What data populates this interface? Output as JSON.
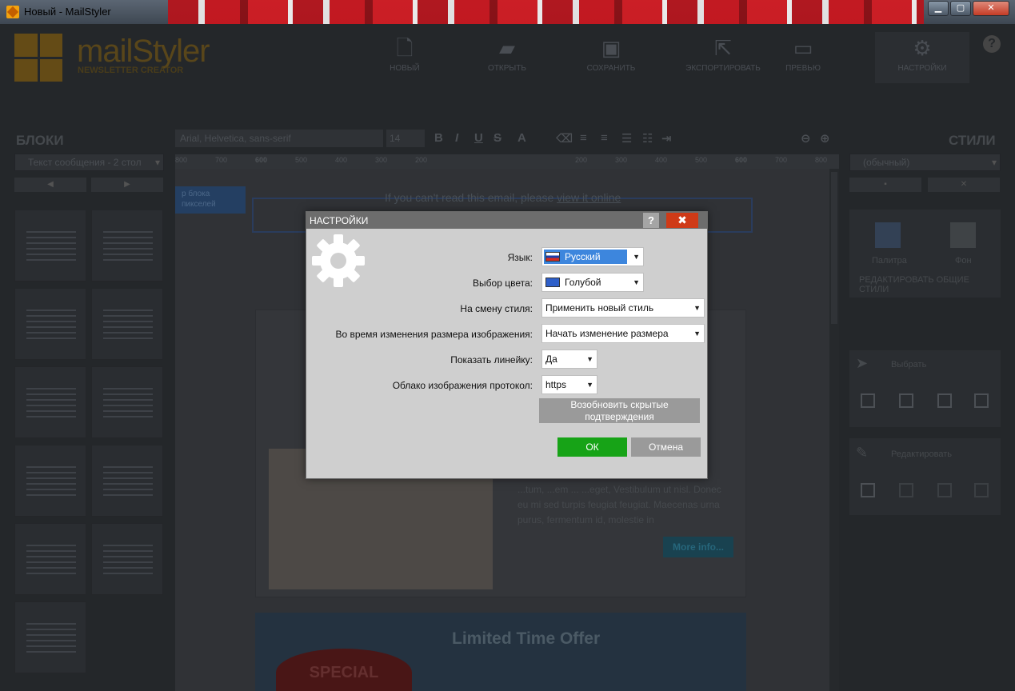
{
  "window": {
    "title": "Новый - MailStyler",
    "minimize": "▁",
    "maximize": "▢",
    "close": "✕"
  },
  "logo": {
    "name": "mailStyler",
    "subtitle": "NEWSLETTER CREATOR"
  },
  "toolbar": [
    {
      "label": "НОВЫЙ",
      "icon": "new-document-icon"
    },
    {
      "label": "ОТКРЫТЬ",
      "icon": "folder-open-icon"
    },
    {
      "label": "СОХРАНИТЬ",
      "icon": "save-icon"
    },
    {
      "label": "ЭКСПОРТИРОВАТЬ",
      "icon": "export-icon"
    },
    {
      "label": "ПРЕВЬЮ",
      "icon": "monitor-icon"
    },
    {
      "label": "НАСТРОЙКИ",
      "icon": "gear-icon"
    }
  ],
  "help_glyph": "?",
  "left_panel": {
    "title": "БЛОКИ",
    "select_value": "Текст сообщения - 2 стол",
    "prev_glyph": "◀",
    "next_glyph": "▶"
  },
  "editor": {
    "font": "Arial, Helvetica, sans-serif",
    "size": "14",
    "ruler_labels": [
      "800",
      "700",
      "600",
      "500",
      "400",
      "300",
      "200",
      "200",
      "300",
      "400",
      "500",
      "600",
      "700",
      "800"
    ],
    "preheader_text": "If you can't read this email, please ",
    "preheader_link": "view it online",
    "block_tag_1": "р блока",
    "block_tag_2": "пикселей",
    "lorem": "...tum, ...em ... ...eget, Vestibulum ut nisl. Donec eu mi sed turpis feugiat feugiat. Maecenas urna purus, fermentum id, molestie in",
    "more_button": "More info...",
    "offer_title": "Limited Time Offer",
    "offer_badge": "SPECIAL"
  },
  "right_panel": {
    "title": "СТИЛИ",
    "select_value": "(обычный)",
    "palette_label": "Палитра",
    "background_label": "Фон",
    "edit_common": "РЕДАКТИРОВАТЬ ОБЩИЕ СТИЛИ",
    "select_label": "Выбрать",
    "edit_label": "Редактировать"
  },
  "dialog": {
    "title": "НАСТРОЙКИ",
    "help": "?",
    "close": "✖",
    "rows": [
      {
        "label": "Язык:",
        "value": "Русский"
      },
      {
        "label": "Выбор цвета:",
        "value": "Голубой"
      },
      {
        "label": "На смену стиля:",
        "value": "Применить новый стиль"
      },
      {
        "label": "Во время изменения размера изображения:",
        "value": "Начать изменение размера"
      },
      {
        "label": "Показать линейку:",
        "value": "Да"
      },
      {
        "label": "Облако изображения протокол:",
        "value": "https"
      }
    ],
    "restore_button_line1": "Возобновить скрытые",
    "restore_button_line2": "подтверждения",
    "ok": "ОК",
    "cancel": "Отмена"
  },
  "colors": {
    "ok_green": "#17a317",
    "close_red": "#cf3a17",
    "highlight_blue": "#3d86dd",
    "swatch_blue": "#2e5fc9"
  }
}
